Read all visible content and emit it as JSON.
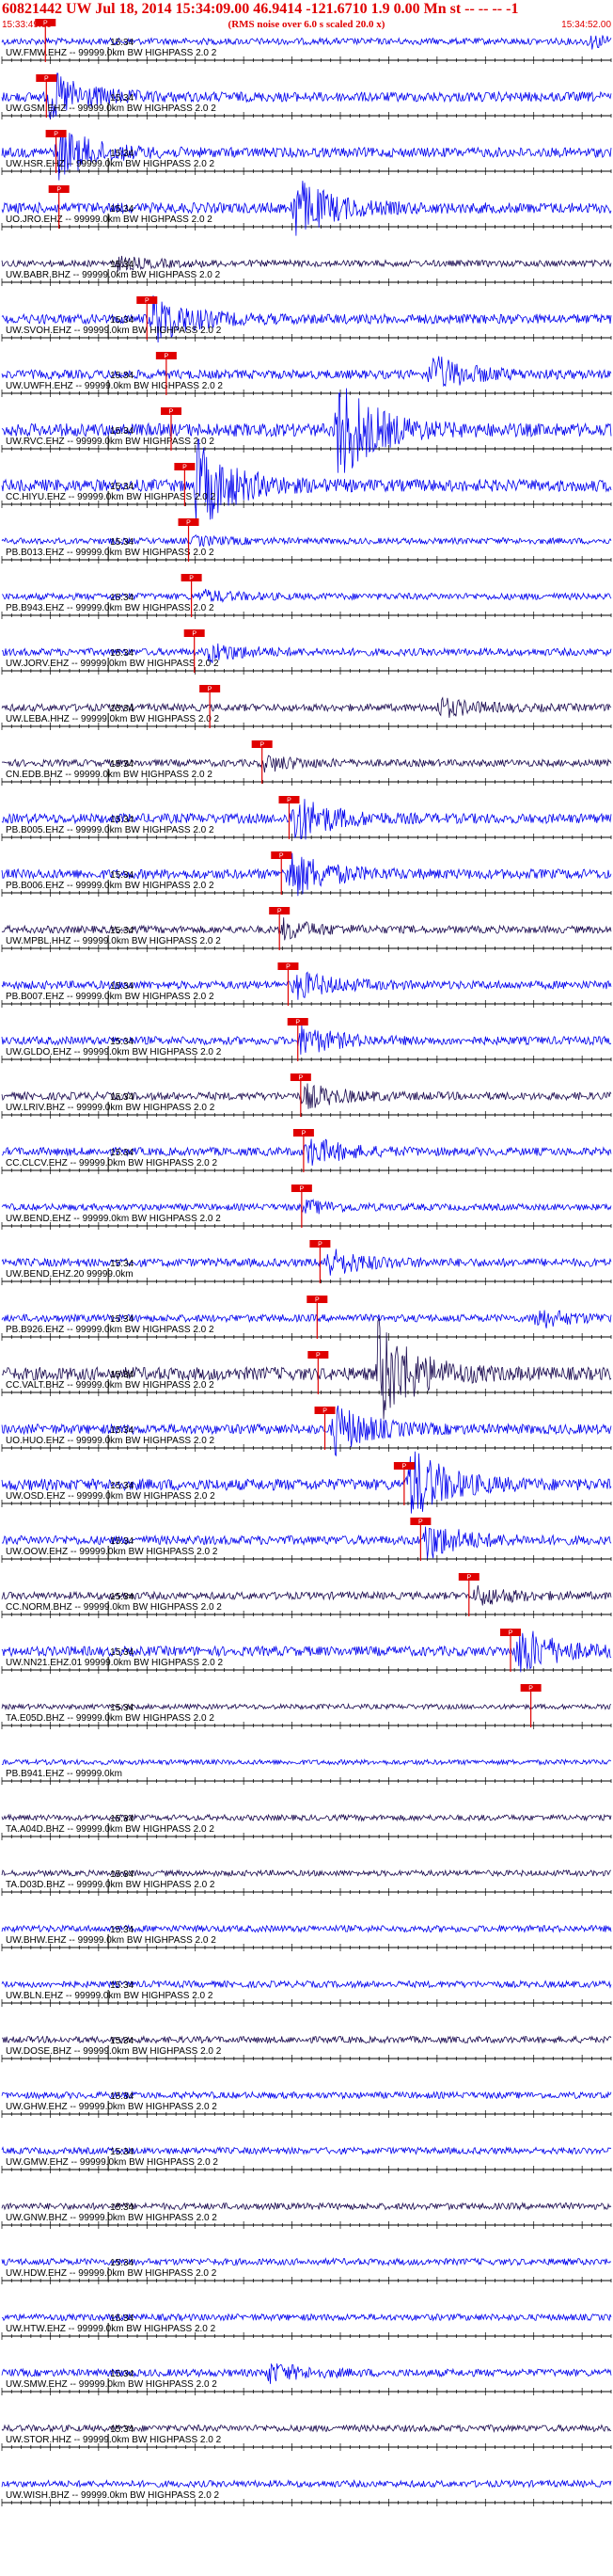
{
  "header": {
    "title": "60821442 UW Jul 18, 2014 15:34:09.00   46.9414 -121.6710  1.9 0.00 Mn st -- -- --  -1",
    "note": "(RMS noise over 6.0 s scaled 20.0 x)",
    "start_time": "15:33:49.00",
    "end_time": "15:34:52.00"
  },
  "colors": {
    "accent": "#e00000",
    "trace_blue": "#0000ee",
    "trace_dark": "#1a0a50",
    "axis": "#000000"
  },
  "chart_data": {
    "type": "line",
    "title": "60821442 UW Jul 18, 2014 15:34:09.00   46.9414 -121.6710  1.9 0.00 Mn st -- -- --  -1",
    "x_unit": "seconds",
    "xlim": [
      0,
      63
    ],
    "minute_tick_label": "15:34",
    "minute_tick_sec": 11,
    "pick_label": "P",
    "series": [
      {
        "label": "UW.FMW.EHZ -- 99999.0km BW  HIGHPASS  2.0  2",
        "color": "#0000ee",
        "pick": 4.5,
        "event": 60.8,
        "amp": 0.2,
        "tick": true
      },
      {
        "label": "UW.GSM.EHZ -- 99999.0km BW  HIGHPASS  2.0  2",
        "color": "#0000ee",
        "pick": 4.6,
        "event": 4.9,
        "amp": 0.6,
        "tick": true
      },
      {
        "label": "UW.HSR.EHZ -- 99999.0km BW  HIGHPASS  2.0  2",
        "color": "#0000ee",
        "pick": 5.6,
        "event": 5.8,
        "amp": 0.6,
        "tick": true
      },
      {
        "label": "UO.JRO.EHZ -- 99999.0km BW  HIGHPASS  2.0  2",
        "color": "#0000ee",
        "pick": 5.9,
        "event": 30.2,
        "amp": 0.7,
        "tick": true
      },
      {
        "label": "UW.BABR.BHZ -- 99999.0km BW  HIGHPASS  2.0  2",
        "color": "#1a0a50",
        "pick": null,
        "event": 12.0,
        "amp": 0.2,
        "tick": true
      },
      {
        "label": "UW.SVOH.EHZ -- 99999.0km BW  HIGHPASS  2.0  2",
        "color": "#0000ee",
        "pick": 15.0,
        "event": 15.6,
        "amp": 0.6,
        "tick": true
      },
      {
        "label": "UW.UWFH.EHZ -- 99999.0km BW  HIGHPASS  2.0  2",
        "color": "#0000ee",
        "pick": 17.0,
        "event": 44.3,
        "amp": 0.5,
        "tick": true
      },
      {
        "label": "UW.RVC.EHZ -- 99999.0km BW  HIGHPASS  2.0  2",
        "color": "#0000ee",
        "pick": 17.5,
        "event": 34.7,
        "amp": 1.0,
        "tick": true
      },
      {
        "label": "CC.HIYU.EHZ -- 99999.0km BW  HIGHPASS  2.0  2",
        "color": "#0000ee",
        "pick": 18.9,
        "event": 20.0,
        "amp": 0.9,
        "tick": true
      },
      {
        "label": "PB.B013.EHZ -- 99999.0km BW  HIGHPASS  2.0  2",
        "color": "#0000ee",
        "pick": 19.3,
        "event": 19.8,
        "amp": 0.15,
        "tick": true
      },
      {
        "label": "PB.B943.EHZ -- 99999.0km BW  HIGHPASS  2.0  2",
        "color": "#0000ee",
        "pick": 19.6,
        "event": 20.4,
        "amp": 0.2,
        "tick": true
      },
      {
        "label": "UW.JORV.EHZ -- 99999.0km BW  HIGHPASS  2.0  2",
        "color": "#0000ee",
        "pick": 19.9,
        "event": 21.3,
        "amp": 0.3,
        "tick": true
      },
      {
        "label": "UW.LEBA.HHZ -- 99999.0km BW  HIGHPASS  2.0  2",
        "color": "#1a0a50",
        "pick": 21.5,
        "event": 45.2,
        "amp": 0.3,
        "tick": true
      },
      {
        "label": "CN.EDB.BHZ -- 99999.0km BW  HIGHPASS  2.0  2",
        "color": "#1a0a50",
        "pick": 26.9,
        "event": 27.1,
        "amp": 0.25,
        "tick": true
      },
      {
        "label": "PB.B005.EHZ -- 99999.0km BW  HIGHPASS  2.0  2",
        "color": "#0000ee",
        "pick": 29.7,
        "event": 30.1,
        "amp": 0.6,
        "tick": true
      },
      {
        "label": "PB.B006.EHZ -- 99999.0km BW  HIGHPASS  2.0  2",
        "color": "#0000ee",
        "pick": 28.9,
        "event": 29.6,
        "amp": 0.6,
        "tick": true
      },
      {
        "label": "UW.MPBL.HHZ -- 99999.0km BW  HIGHPASS  2.0  2",
        "color": "#1a0a50",
        "pick": 28.7,
        "event": 29.0,
        "amp": 0.3,
        "tick": true
      },
      {
        "label": "PB.B007.EHZ -- 99999.0km BW  HIGHPASS  2.0  2",
        "color": "#0000ee",
        "pick": 29.6,
        "event": 30.3,
        "amp": 0.4,
        "tick": true
      },
      {
        "label": "UW.GLDO.EHZ -- 99999.0km BW  HIGHPASS  2.0  2",
        "color": "#0000ee",
        "pick": 30.6,
        "event": 30.9,
        "amp": 0.4,
        "tick": true
      },
      {
        "label": "UW.LRIV.BHZ -- 99999.0km BW  HIGHPASS  2.0  2",
        "color": "#1a0a50",
        "pick": 30.9,
        "event": 31.3,
        "amp": 0.35,
        "tick": true
      },
      {
        "label": "CC.CLCV.EHZ -- 99999.0km BW  HIGHPASS  2.0  2",
        "color": "#0000ee",
        "pick": 31.2,
        "event": 31.6,
        "amp": 0.4,
        "tick": true
      },
      {
        "label": "UW.BEND.EHZ -- 99999.0km BW  HIGHPASS  2.0  2",
        "color": "#0000ee",
        "pick": 31.0,
        "event": 31.4,
        "amp": 0.2,
        "tick": false
      },
      {
        "label": "UW.BEND.EHZ.20 99999.0km",
        "color": "#0000ee",
        "pick": 32.9,
        "event": 33.5,
        "amp": 0.4,
        "tick": true
      },
      {
        "label": "PB.B926.EHZ -- 99999.0km BW  HIGHPASS  2.0  2",
        "color": "#0000ee",
        "pick": 32.6,
        "event": 55.1,
        "amp": 0.3,
        "tick": true
      },
      {
        "label": "CC.VALT.BHZ -- 99999.0km BW  HIGHPASS  2.0  2",
        "color": "#1a0a50",
        "pick": 32.7,
        "event": 38.8,
        "amp": 1.0,
        "tick": true
      },
      {
        "label": "UO.HUO.EHZ -- 99999.0km BW  HIGHPASS  2.0  2",
        "color": "#0000ee",
        "pick": 33.4,
        "event": 34.3,
        "amp": 0.6,
        "tick": true
      },
      {
        "label": "UW.OSD.EHZ -- 99999.0km BW  HIGHPASS  2.0  2",
        "color": "#0000ee",
        "pick": 41.6,
        "event": 42.1,
        "amp": 0.8,
        "tick": true
      },
      {
        "label": "UW.OOW.EHZ -- 99999.0km BW  HIGHPASS  2.0  2",
        "color": "#0000ee",
        "pick": 43.3,
        "event": 43.8,
        "amp": 0.5,
        "tick": true
      },
      {
        "label": "CC.NORM.BHZ -- 99999.0km BW  HIGHPASS  2.0  2",
        "color": "#1a0a50",
        "pick": 48.3,
        "event": 49.0,
        "amp": 0.3,
        "tick": true
      },
      {
        "label": "UW.NN21.EHZ.01 99999.0km BW  HIGHPASS  2.0  2",
        "color": "#0000ee",
        "pick": 52.6,
        "event": 53.4,
        "amp": 0.6,
        "tick": true
      },
      {
        "label": "TA.E05D.BHZ -- 99999.0km BW  HIGHPASS  2.0  2",
        "color": "#1a0a50",
        "pick": 54.7,
        "event": null,
        "amp": 0.0,
        "tick": true
      },
      {
        "label": "PB.B941.EHZ -- 99999.0km",
        "color": "#0000ee",
        "pick": null,
        "event": null,
        "amp": 0.0,
        "tick": false
      },
      {
        "label": "TA.A04D.BHZ -- 99999.0km BW  HIGHPASS  2.0  2",
        "color": "#1a0a50",
        "pick": null,
        "event": null,
        "amp": 0.1,
        "tick": true
      },
      {
        "label": "TA.D03D.BHZ -- 99999.0km BW  HIGHPASS  2.0  2",
        "color": "#1a0a50",
        "pick": null,
        "event": null,
        "amp": 0.1,
        "tick": true
      },
      {
        "label": "UW.BHW.EHZ -- 99999.0km BW  HIGHPASS  2.0  2",
        "color": "#0000ee",
        "pick": null,
        "event": null,
        "amp": 0.2,
        "tick": true
      },
      {
        "label": "UW.BLN.EHZ -- 99999.0km BW  HIGHPASS  2.0  2",
        "color": "#0000ee",
        "pick": null,
        "event": null,
        "amp": 0.2,
        "tick": true
      },
      {
        "label": "UW.DOSE.BHZ -- 99999.0km BW  HIGHPASS  2.0  2",
        "color": "#1a0a50",
        "pick": null,
        "event": null,
        "amp": 0.2,
        "tick": true
      },
      {
        "label": "UW.GHW.EHZ -- 99999.0km BW  HIGHPASS  2.0  2",
        "color": "#0000ee",
        "pick": null,
        "event": null,
        "amp": 0.2,
        "tick": true
      },
      {
        "label": "UW.GMW.EHZ -- 99999.0km BW  HIGHPASS  2.0  2",
        "color": "#0000ee",
        "pick": null,
        "event": null,
        "amp": 0.2,
        "tick": true
      },
      {
        "label": "UW.GNW.BHZ -- 99999.0km BW  HIGHPASS  2.0  2",
        "color": "#1a0a50",
        "pick": null,
        "event": null,
        "amp": 0.2,
        "tick": true
      },
      {
        "label": "UW.HDW.EHZ -- 99999.0km BW  HIGHPASS  2.0  2",
        "color": "#0000ee",
        "pick": null,
        "event": null,
        "amp": 0.2,
        "tick": true
      },
      {
        "label": "UW.HTW.EHZ -- 99999.0km BW  HIGHPASS  2.0  2",
        "color": "#0000ee",
        "pick": null,
        "event": null,
        "amp": 0.2,
        "tick": true
      },
      {
        "label": "UW.SMW.EHZ -- 99999.0km BW  HIGHPASS  2.0  2",
        "color": "#0000ee",
        "pick": null,
        "event": 27.5,
        "amp": 0.3,
        "tick": true
      },
      {
        "label": "UW.STOR.HHZ -- 99999.0km BW  HIGHPASS  2.0  2",
        "color": "#1a0a50",
        "pick": null,
        "event": null,
        "amp": 0.2,
        "tick": true
      },
      {
        "label": "UW.WISH.BHZ -- 99999.0km BW  HIGHPASS  2.0  2",
        "color": "#0000ee",
        "pick": null,
        "event": null,
        "amp": 0.2,
        "tick": false
      }
    ]
  }
}
